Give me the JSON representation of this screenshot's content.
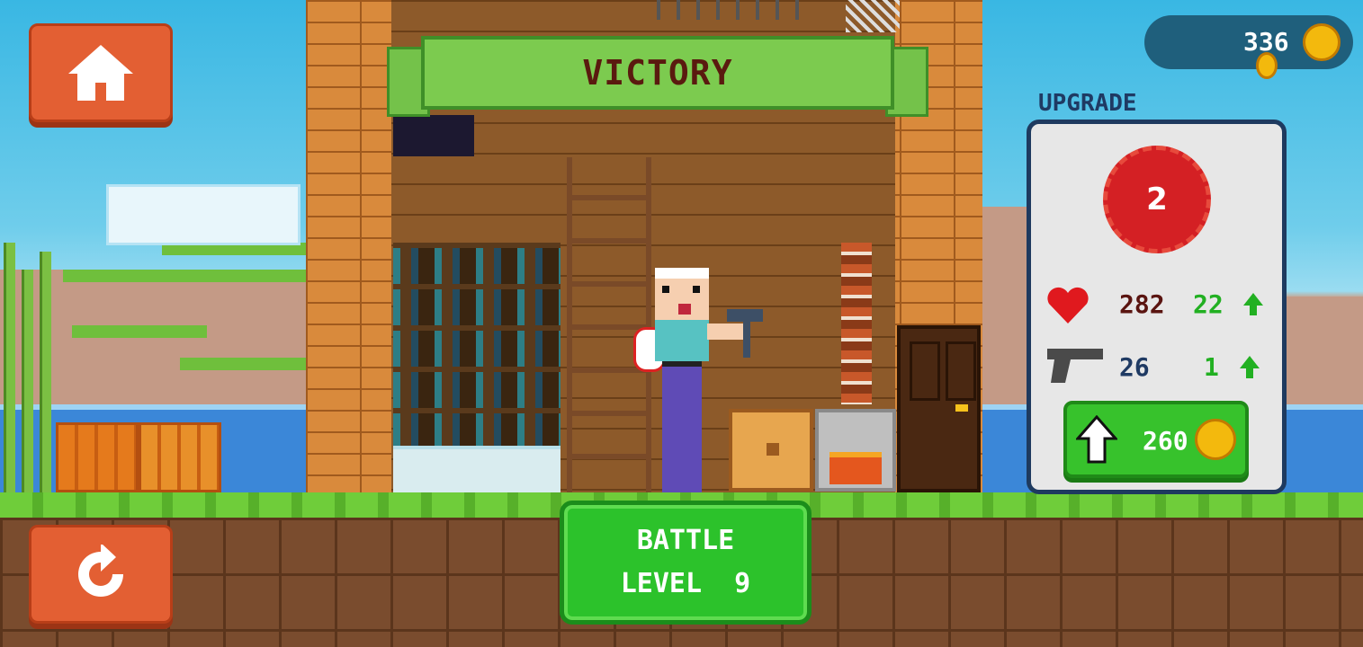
{
  "banner": {
    "title": "VICTORY"
  },
  "hud": {
    "coins": "336",
    "home_icon": "home-icon",
    "restart_icon": "restart-icon"
  },
  "upgrade": {
    "title": "UPGRADE",
    "level": "2",
    "health": {
      "value": "282",
      "increase": "22",
      "icon": "heart-icon"
    },
    "damage": {
      "value": "26",
      "increase": "1",
      "icon": "pistol-icon"
    },
    "cost": "260"
  },
  "battle": {
    "line1": "BATTLE",
    "line2": "LEVEL  9"
  },
  "colors": {
    "accent_orange": "#e35f33",
    "button_green": "#2cc22b",
    "panel_navy": "#1e3a5f",
    "badge_red": "#d42024",
    "coin_gold": "#f3b90d"
  }
}
